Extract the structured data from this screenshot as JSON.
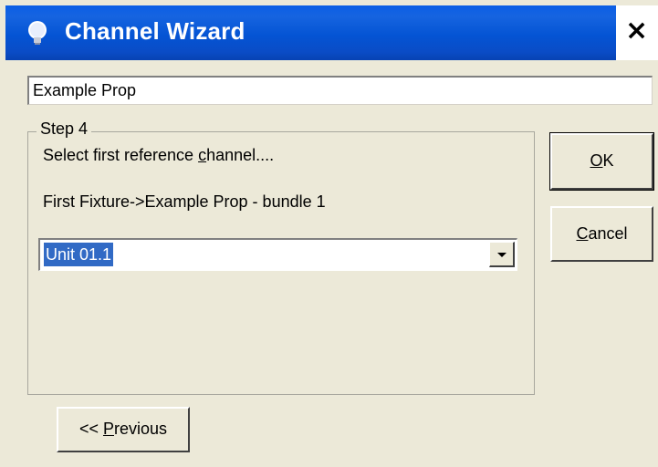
{
  "window": {
    "title": "Channel Wizard",
    "title_icon": "lightbulb-icon",
    "close_glyph": "×"
  },
  "name_field": {
    "value": "Example Prop"
  },
  "step_group": {
    "legend": "Step 4",
    "instruction_before": "Select first reference ",
    "instruction_accel": "c",
    "instruction_after": "hannel....",
    "path_text": "First Fixture->Example Prop - bundle 1",
    "channel_combo": {
      "selected": "Unit 01.1",
      "arrow_icon": "chevron-down-icon"
    }
  },
  "buttons": {
    "ok": {
      "accel": "O",
      "rest": "K"
    },
    "cancel": {
      "accel": "C",
      "rest": "ancel"
    },
    "previous": {
      "prefix": "<< ",
      "accel": "P",
      "rest": "revious"
    }
  },
  "colors": {
    "title_bar": "#0a54d6",
    "selection": "#316ac5",
    "dialog_bg": "#ece9d8"
  }
}
